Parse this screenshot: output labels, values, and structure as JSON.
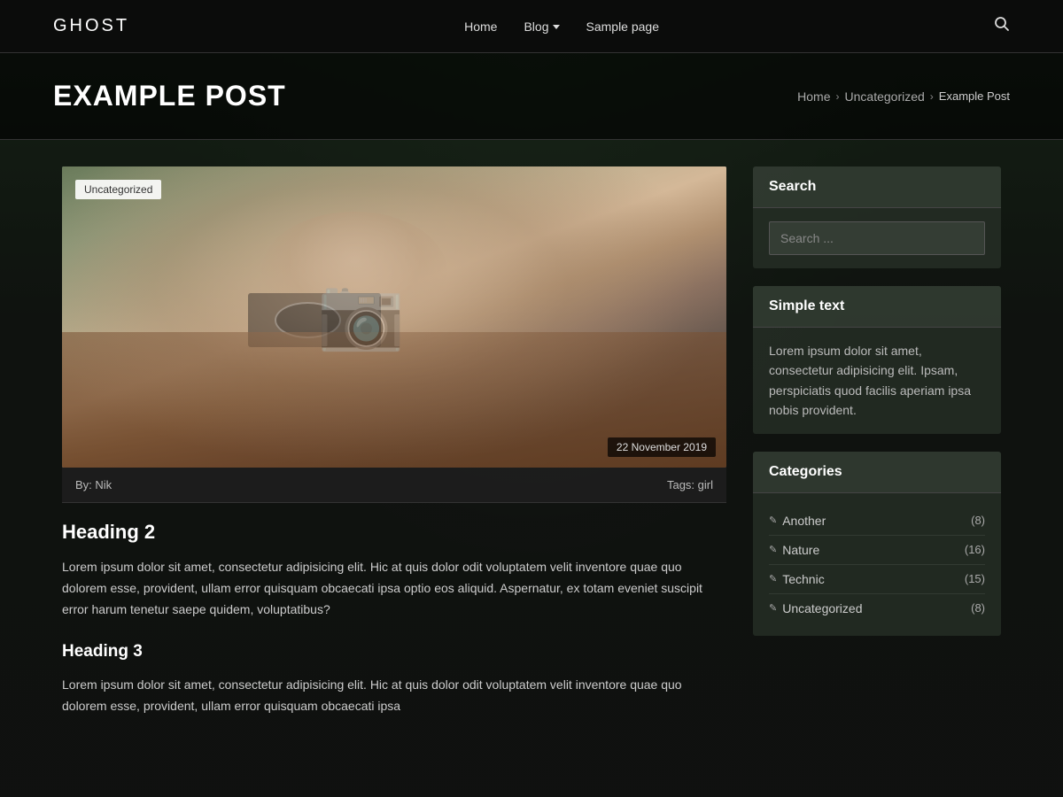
{
  "site": {
    "logo": "GHOST"
  },
  "nav": {
    "home_label": "Home",
    "blog_label": "Blog",
    "sample_page_label": "Sample page"
  },
  "page_hero": {
    "title": "EXAMPLE POST",
    "breadcrumb": {
      "home": "Home",
      "category": "Uncategorized",
      "current": "Example Post"
    }
  },
  "post": {
    "category_badge": "Uncategorized",
    "date": "22 November 2019",
    "author": "By: Nik",
    "tags": "Tags: girl",
    "heading2": "Heading 2",
    "paragraph1": "Lorem ipsum dolor sit amet, consectetur adipisicing elit. Hic at quis dolor odit voluptatem velit inventore quae quo dolorem esse, provident, ullam error quisquam obcaecati ipsa optio eos aliquid. Aspernatur, ex totam eveniet suscipit error harum tenetur saepe quidem, voluptatibus?",
    "heading3": "Heading 3",
    "paragraph2": "Lorem ipsum dolor sit amet, consectetur adipisicing elit. Hic at quis dolor odit voluptatem velit inventore quae quo dolorem esse, provident, ullam error quisquam obcaecati ipsa"
  },
  "sidebar": {
    "search_widget": {
      "title": "Search",
      "placeholder": "Search ..."
    },
    "text_widget": {
      "title": "Simple text",
      "body": "Lorem ipsum dolor sit amet, consectetur adipisicing elit. Ipsam, perspiciatis quod facilis aperiam ipsa nobis provident."
    },
    "categories_widget": {
      "title": "Categories",
      "items": [
        {
          "label": "Another",
          "count": "(8)"
        },
        {
          "label": "Nature",
          "count": "(16)"
        },
        {
          "label": "Technic",
          "count": "(15)"
        },
        {
          "label": "Uncategorized",
          "count": "(8)"
        }
      ]
    }
  }
}
